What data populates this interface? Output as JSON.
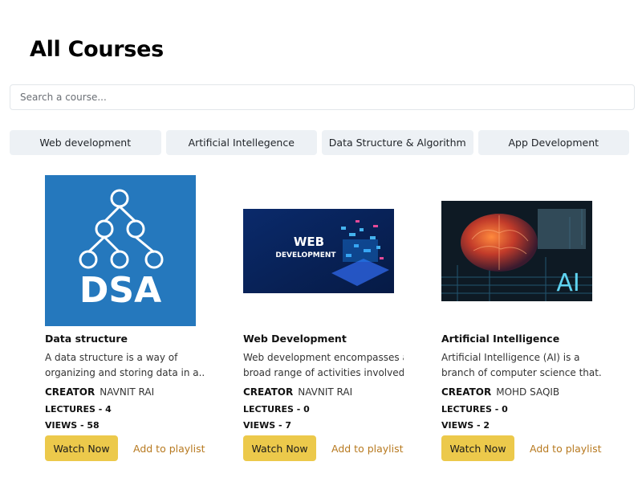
{
  "page": {
    "title": "All Courses"
  },
  "search": {
    "placeholder": "Search a course..."
  },
  "filters": [
    {
      "label": "Web development"
    },
    {
      "label": "Artificial Intellegence"
    },
    {
      "label": "Data Structure & Algorithm"
    },
    {
      "label": "App Development"
    }
  ],
  "courses": [
    {
      "title": "Data structure",
      "desc_line1": "A data structure is a way of",
      "desc_line2": "organizing and storing data in a...",
      "creator_label": "CREATOR",
      "creator": "NAVNIT RAI",
      "lectures": "LECTURES - 4",
      "views": "VIEWS - 58",
      "watch_label": "Watch Now",
      "playlist_label": "Add to playlist",
      "thumb_text": "DSA"
    },
    {
      "title": "Web Development",
      "desc_line1": "Web development encompasses a",
      "desc_line2": "broad range of activities involved...",
      "creator_label": "CREATOR",
      "creator": "NAVNIT RAI",
      "lectures": "LECTURES - 0",
      "views": "VIEWS - 7",
      "watch_label": "Watch Now",
      "playlist_label": "Add to playlist",
      "thumb_text_1": "WEB",
      "thumb_text_2": "DEVELOPMENT"
    },
    {
      "title": "Artificial Intelligence",
      "desc_line1": "Artificial Intelligence (AI) is a",
      "desc_line2": "branch of computer science that...",
      "creator_label": "CREATOR",
      "creator": "MOHD SAQIB",
      "lectures": "LECTURES - 0",
      "views": "VIEWS - 2",
      "watch_label": "Watch Now",
      "playlist_label": "Add to playlist",
      "thumb_text": "AI"
    }
  ],
  "colors": {
    "accent": "#ecc94b",
    "link": "#b7791f",
    "filter_bg": "#edf1f5",
    "dsa_blue": "#2578bd"
  }
}
